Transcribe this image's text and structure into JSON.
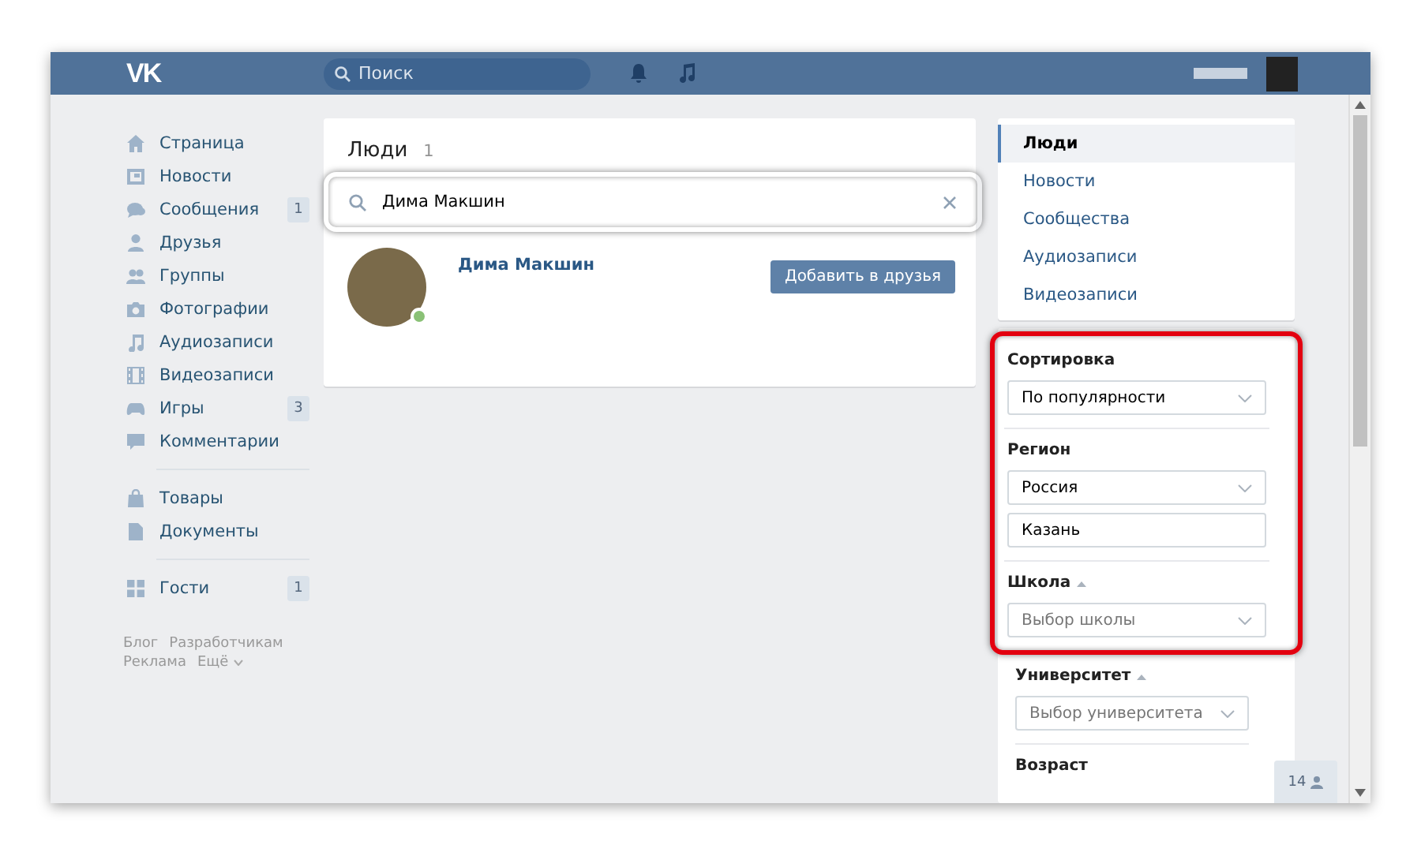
{
  "header": {
    "logo": "VK",
    "search": {
      "placeholder": "Поиск"
    }
  },
  "sidebar": {
    "groups": [
      [
        {
          "label": "Страница"
        },
        {
          "label": "Новости"
        },
        {
          "label": "Сообщения",
          "counter": "1"
        },
        {
          "label": "Друзья"
        },
        {
          "label": "Группы"
        },
        {
          "label": "Фотографии"
        },
        {
          "label": "Аудиозаписи"
        },
        {
          "label": "Видеозаписи"
        },
        {
          "label": "Игры",
          "counter": "3"
        },
        {
          "label": "Комментарии"
        }
      ],
      [
        {
          "label": "Товары"
        },
        {
          "label": "Документы"
        }
      ],
      [
        {
          "label": "Гости",
          "counter": "1"
        }
      ]
    ],
    "footer_links": [
      {
        "label": "Блог"
      },
      {
        "label": "Разработчикам"
      },
      {
        "label": "Реклама"
      },
      {
        "label": "Ещё",
        "dropdown": true
      }
    ]
  },
  "people": {
    "title": "Люди",
    "count": "1",
    "search": {
      "value": "Дима Макшин",
      "highlighted": true
    },
    "results": [
      {
        "name": "Дима Макшин",
        "online": true,
        "action": "Добавить в друзья"
      }
    ]
  },
  "section_menu": {
    "items": [
      {
        "label": "Люди",
        "selected": true
      },
      {
        "label": "Новости",
        "selected": false
      },
      {
        "label": "Сообщества",
        "selected": false
      },
      {
        "label": "Аудиозаписи",
        "selected": false
      },
      {
        "label": "Видеозаписи",
        "selected": false
      }
    ]
  },
  "filters": {
    "sections": [
      {
        "label": "Сортировка",
        "highlighted": true,
        "controls": [
          {
            "kind": "select",
            "value": "По популярности"
          }
        ]
      },
      {
        "label": "Регион",
        "highlighted": true,
        "controls": [
          {
            "kind": "select",
            "value": "Россия"
          },
          {
            "kind": "input",
            "value": "Казань"
          }
        ]
      },
      {
        "label": "Школа",
        "highlighted": true,
        "expanded": true,
        "controls": [
          {
            "kind": "select",
            "placeholder": "Выбор школы"
          }
        ]
      },
      {
        "label": "Университет",
        "highlighted": false,
        "expanded": true,
        "controls": [
          {
            "kind": "select",
            "placeholder": "Выбор университета"
          }
        ]
      },
      {
        "label": "Возраст",
        "highlighted": false
      }
    ]
  },
  "online_friends": {
    "count": "14"
  }
}
